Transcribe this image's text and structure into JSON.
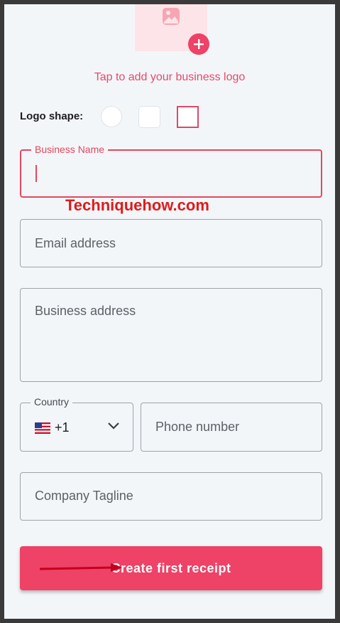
{
  "logo": {
    "tap_text": "Tap to add your business logo",
    "image_icon": "image-icon",
    "add_icon": "plus-icon"
  },
  "logo_shape": {
    "label": "Logo shape:",
    "options": [
      "circle",
      "rounded",
      "square"
    ],
    "selected": "square"
  },
  "form": {
    "business_name_label": "Business Name",
    "business_name_value": "",
    "email_placeholder": "Email address",
    "address_placeholder": "Business address",
    "country_label": "Country",
    "country_code": "+1",
    "country_flag": "flag-us-icon",
    "phone_placeholder": "Phone number",
    "tagline_placeholder": "Company Tagline"
  },
  "watermark": "Techniquehow.com",
  "cta": {
    "label": "Create first receipt"
  },
  "colors": {
    "accent": "#ee4266",
    "label_red": "#e4475f",
    "watermark_red": "#e01a1a"
  }
}
